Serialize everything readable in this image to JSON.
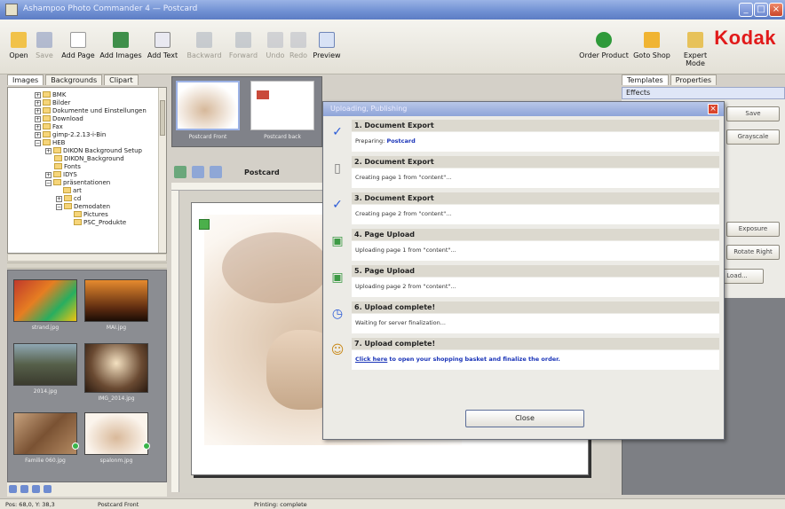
{
  "window": {
    "title": "Ashampoo Photo Commander 4 — Postcard"
  },
  "toolbar": {
    "items": [
      {
        "label": "Open"
      },
      {
        "label": "Save"
      },
      {
        "label": "Add Page"
      },
      {
        "label": "Add Images"
      },
      {
        "label": "Add Text"
      },
      {
        "label": "Backward"
      },
      {
        "label": "Forward"
      },
      {
        "label": "Undo"
      },
      {
        "label": "Redo"
      },
      {
        "label": "Preview"
      },
      {
        "label": "Order Product"
      },
      {
        "label": "Goto Shop"
      },
      {
        "label": "Expert Mode"
      }
    ],
    "brand": "Kodak"
  },
  "left": {
    "tabs": [
      "Images",
      "Backgrounds",
      "Clipart"
    ],
    "tree": [
      "BMK",
      "Bilder",
      "Dokumente und Einstellungen",
      "Download",
      "Fax",
      "gimp-2.2.13-i-Bin",
      "HEB",
      "DIKON Background Setup",
      "DIKON_Background",
      "Fonts",
      "IDYS",
      "präsentationen",
      "art",
      "cd",
      "Demodaten",
      "Pictures",
      "PSC_Produkte"
    ],
    "thumbs": [
      "strand.jpg",
      "MAI.jpg",
      "2014.jpg",
      "IMG_2014.jpg",
      "Familie 060.jpg",
      "spalonm.jpg"
    ]
  },
  "pages": {
    "captions": [
      "Postcard Front",
      "Postcard back"
    ]
  },
  "editor": {
    "label": "Postcard"
  },
  "right": {
    "tabs": [
      "Templates",
      "Properties"
    ],
    "effects_label": "Effects",
    "buttons": [
      "Save",
      "Grayscale",
      "Exposure",
      "Rotate Right",
      "Load..."
    ]
  },
  "dialog": {
    "title": "Uploading, Publishing",
    "steps": [
      {
        "icon": "check-icon",
        "title": "1. Document Export",
        "detail_prefix": "Preparing:",
        "detail_highlight": "Postcard"
      },
      {
        "icon": "page-icon",
        "title": "2. Document Export",
        "detail_prefix": "Creating page 1 from \"content\"...",
        "detail_highlight": ""
      },
      {
        "icon": "check-icon",
        "title": "3. Document Export",
        "detail_prefix": "Creating page 2 from \"content\"...",
        "detail_highlight": ""
      },
      {
        "icon": "upload-icon",
        "title": "4. Page Upload",
        "detail_prefix": "Uploading page 1 from \"content\"...",
        "detail_highlight": ""
      },
      {
        "icon": "upload-icon",
        "title": "5. Page Upload",
        "detail_prefix": "Uploading page 2 from \"content\"...",
        "detail_highlight": ""
      },
      {
        "icon": "clock-icon",
        "title": "6. Upload complete!",
        "detail_prefix": "Waiting for server finalization...",
        "detail_highlight": ""
      },
      {
        "icon": "person-icon",
        "title": "7. Upload complete!",
        "detail_link": "Click here",
        "detail_suffix": "to open your shopping basket and finalize the order."
      }
    ],
    "close_label": "Close"
  },
  "status": {
    "coords": "Pos: 68,0, Y:  38,3",
    "page": "Postcard Front",
    "msg": "Printing: complete"
  }
}
